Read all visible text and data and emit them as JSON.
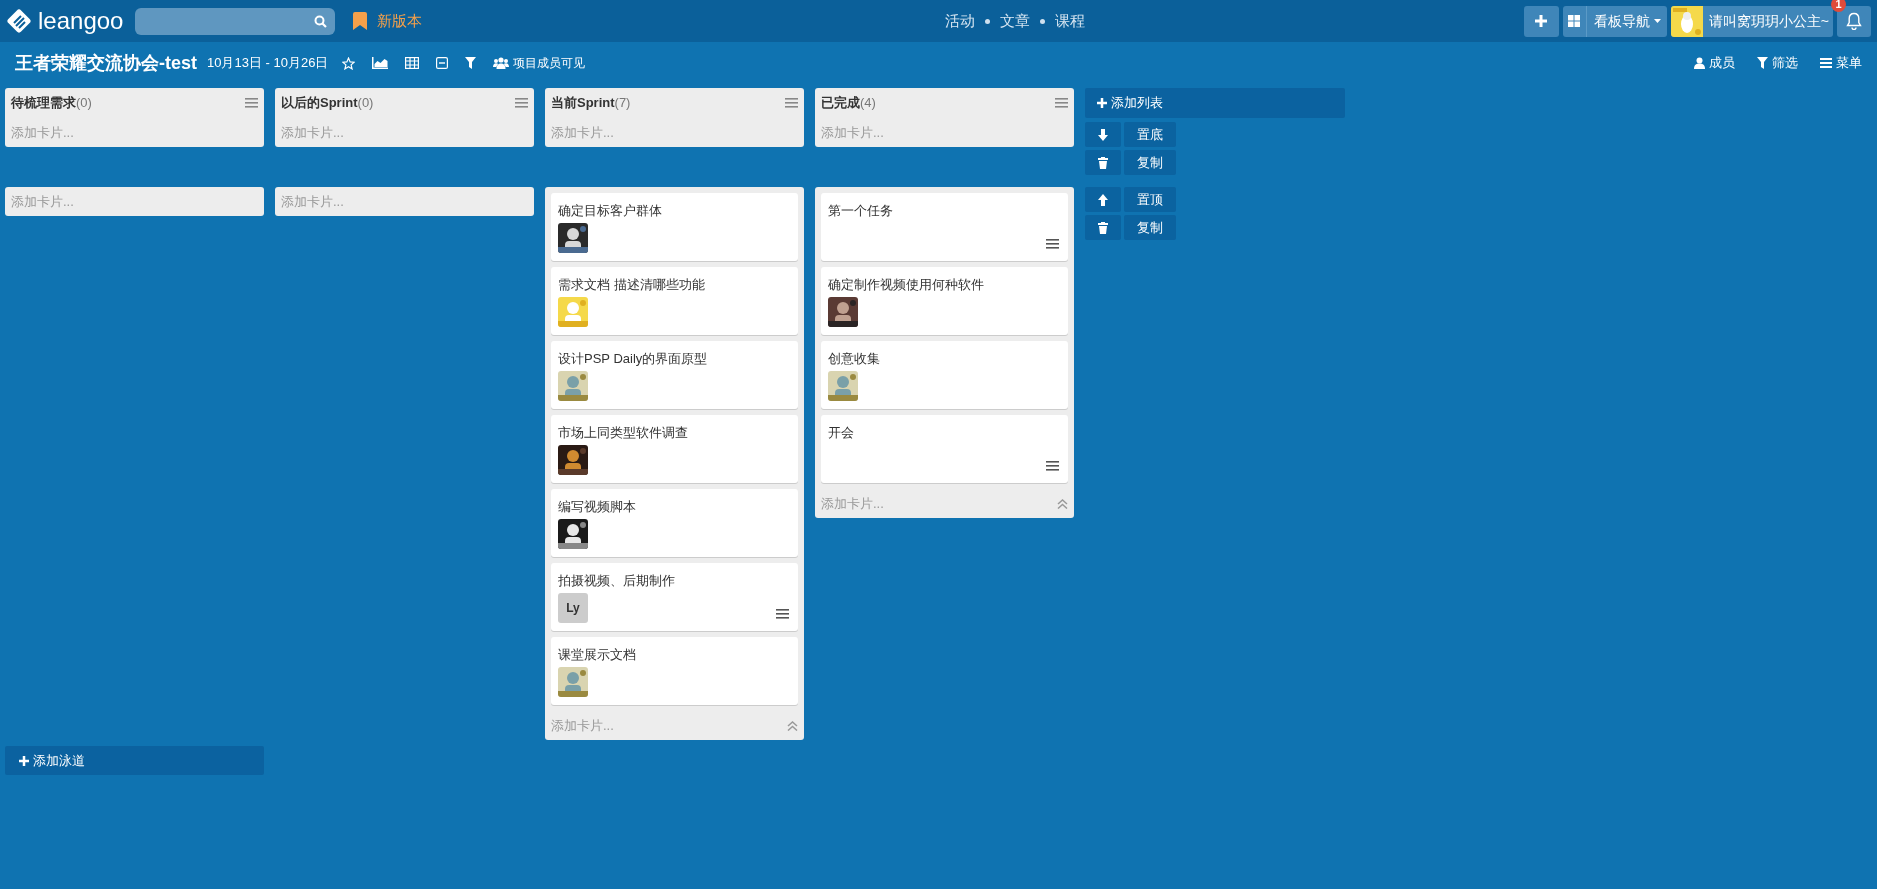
{
  "topbar": {
    "logo": "leangoo",
    "new_version": "新版本",
    "nav": [
      "活动",
      "文章",
      "课程"
    ],
    "board_nav": "看板导航",
    "user": "请叫窝玥玥小公主~",
    "notifications": "1"
  },
  "board": {
    "title": "王者荣耀交流协会-test",
    "dates": "10月13日 - 10月26日",
    "visibility": "项目成员可见",
    "actions": [
      {
        "kind": "user",
        "label": "成员"
      },
      {
        "kind": "filter",
        "label": "筛选"
      },
      {
        "kind": "menu",
        "label": "菜单"
      }
    ]
  },
  "lists": [
    {
      "title": "待梳理需求",
      "count": "(0)"
    },
    {
      "title": "以后的Sprint",
      "count": "(0)"
    },
    {
      "title": "当前Sprint",
      "count": "(7)"
    },
    {
      "title": "已完成",
      "count": "(4)"
    }
  ],
  "add_list": "添加列表",
  "lanes": [
    {
      "columns": [
        {
          "add_card": "添加卡片..."
        },
        {
          "add_card": "添加卡片..."
        },
        {
          "add_card": "添加卡片..."
        },
        {
          "add_card": "添加卡片..."
        }
      ],
      "controls": [
        {
          "kind": "down",
          "label": "置底"
        },
        {
          "kind": "trash",
          "label": "复制"
        }
      ]
    },
    {
      "columns": [
        {
          "add_card": "添加卡片..."
        },
        {
          "add_card": "添加卡片..."
        },
        {
          "add_card": "添加卡片...",
          "cards": [
            {
              "title": "确定目标客户群体",
              "description": false
            },
            {
              "title": "需求文档 描述清哪些功能",
              "description": false
            },
            {
              "title": "设计PSP Daily的界面原型",
              "description": false
            },
            {
              "title": "市场上同类型软件调查",
              "description": false
            },
            {
              "title": "编写视频脚本",
              "description": false
            },
            {
              "title": "拍摄视频、后期制作",
              "avatar": {
                "kind": "initials",
                "text": "Ly"
              },
              "description": true
            },
            {
              "title": "课堂展示文档",
              "description": false
            }
          ]
        },
        {
          "add_card": "添加卡片...",
          "cards": [
            {
              "title": "第一个任务",
              "description": true
            },
            {
              "title": "确定制作视频使用何种软件",
              "description": false
            },
            {
              "title": "创意收集",
              "description": false
            },
            {
              "title": "开会",
              "description": true
            }
          ]
        }
      ],
      "controls": [
        {
          "kind": "up",
          "label": "置顶"
        },
        {
          "kind": "trash",
          "label": "复制"
        }
      ]
    }
  ],
  "add_lane": "添加泳道"
}
